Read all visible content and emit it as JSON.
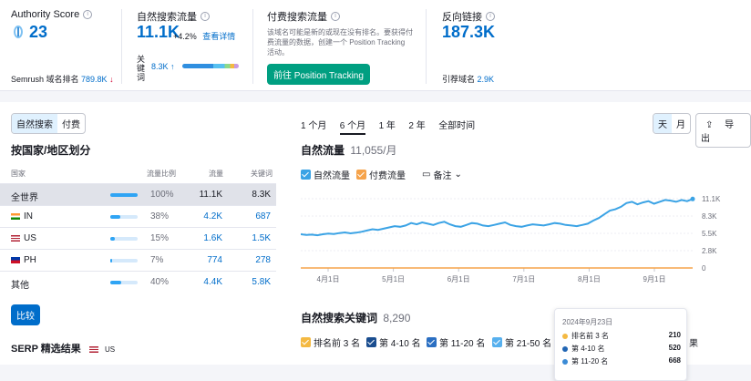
{
  "stats": {
    "authority": {
      "title": "Authority Score",
      "value": "23",
      "rank_label": "Semrush 域名排名",
      "rank_value": "789.8K",
      "rank_arrow": "↓"
    },
    "organic": {
      "title": "自然搜索流量",
      "value": "11.1K",
      "change": "+4.2%",
      "details_link": "查看详情",
      "kw_label": "关键词",
      "kw_value": "8.3K",
      "kw_arrow": "↑"
    },
    "paid": {
      "title": "付费搜索流量",
      "desc_line1": "该域名可能是新的或现在没有排名。要获得付",
      "desc_line2": "费流量的数据，创建一个 Position Tracking",
      "desc_line3": "活动。",
      "button": "前往 Position Tracking"
    },
    "backlinks": {
      "title": "反向链接",
      "value": "187.3K",
      "ref_label": "引荐域名",
      "ref_value": "2.9K"
    }
  },
  "left": {
    "toggle": [
      "自然搜索",
      "付费"
    ],
    "section_title": "按国家/地区划分",
    "headers": [
      "国家",
      "流量比例",
      "流量",
      "关键词"
    ],
    "rows": [
      {
        "country": "全世界",
        "pct": "100%",
        "traffic": "11.1K",
        "keywords": "8.3K",
        "share": 1.0
      },
      {
        "country": "IN",
        "pct": "38%",
        "traffic": "4.2K",
        "keywords": "687",
        "share": 0.38
      },
      {
        "country": "US",
        "pct": "15%",
        "traffic": "1.6K",
        "keywords": "1.5K",
        "share": 0.15
      },
      {
        "country": "PH",
        "pct": "7%",
        "traffic": "774",
        "keywords": "278",
        "share": 0.07
      },
      {
        "country": "其他",
        "pct": "40%",
        "traffic": "4.4K",
        "keywords": "5.8K",
        "share": 0.4
      }
    ],
    "compare_button": "比较",
    "serp_title": "SERP 精选结果",
    "serp_country": "US"
  },
  "right": {
    "periods": [
      "1 个月",
      "6 个月",
      "1 年",
      "2 年",
      "全部时间"
    ],
    "active_period": "6 个月",
    "granularity": [
      "天",
      "月"
    ],
    "export": "导出",
    "traffic_title": "自然流量",
    "traffic_value": "11,055/月",
    "legend": {
      "organic": "自然流量",
      "paid": "付费流量",
      "notes": "备注"
    },
    "kw_title": "自然搜索关键词",
    "kw_value": "8,290",
    "kw_legend": [
      "排名前 3 名",
      "第 4-10 名",
      "第 11-20 名",
      "第 21-50 名"
    ],
    "kw_legend_cut": "果"
  },
  "tooltip": {
    "date": "2024年9月23日",
    "rows": [
      {
        "label": "排名前 3 名",
        "value": "210",
        "color": "#f4b942"
      },
      {
        "label": "第 4-10 名",
        "value": "520",
        "color": "#2266b4"
      },
      {
        "label": "第 11-20 名",
        "value": "668",
        "color": "#3b8bd6"
      }
    ]
  },
  "chart_data": {
    "type": "line",
    "x_ticks": [
      "4月1日",
      "5月1日",
      "6月1日",
      "7月1日",
      "8月1日",
      "9月1日"
    ],
    "y_ticks": [
      "11.1K",
      "8.3K",
      "5.5K",
      "2.8K",
      "0"
    ],
    "ylim": [
      0,
      11100
    ],
    "series": [
      {
        "name": "自然流量",
        "color": "#3ba3e5",
        "values": [
          5400,
          5300,
          5350,
          5250,
          5400,
          5500,
          5450,
          5600,
          5700,
          5550,
          5650,
          5800,
          6000,
          6200,
          6100,
          6300,
          6500,
          6700,
          6600,
          6800,
          7200,
          7000,
          7300,
          7100,
          6900,
          7200,
          7400,
          7000,
          6700,
          6600,
          6900,
          7200,
          7100,
          6800,
          6700,
          6900,
          7100,
          7300,
          6900,
          6700,
          6600,
          6800,
          7000,
          6900,
          6800,
          7000,
          7200,
          7100,
          6900,
          6800,
          6700,
          6900,
          7100,
          7600,
          8000,
          8600,
          9200,
          9400,
          9800,
          10400,
          10600,
          10200,
          10500,
          10700,
          10300,
          10600,
          10900,
          10800,
          10600,
          10900,
          10700,
          11055
        ]
      },
      {
        "name": "付费流量",
        "color": "#f6a34a",
        "values": [
          0,
          0,
          0,
          0,
          0,
          0,
          0,
          0,
          0,
          0,
          0,
          0
        ]
      }
    ],
    "colors": {
      "accent": "#006dca",
      "organic": "#3ba3e5",
      "paid": "#f6a34a"
    }
  }
}
